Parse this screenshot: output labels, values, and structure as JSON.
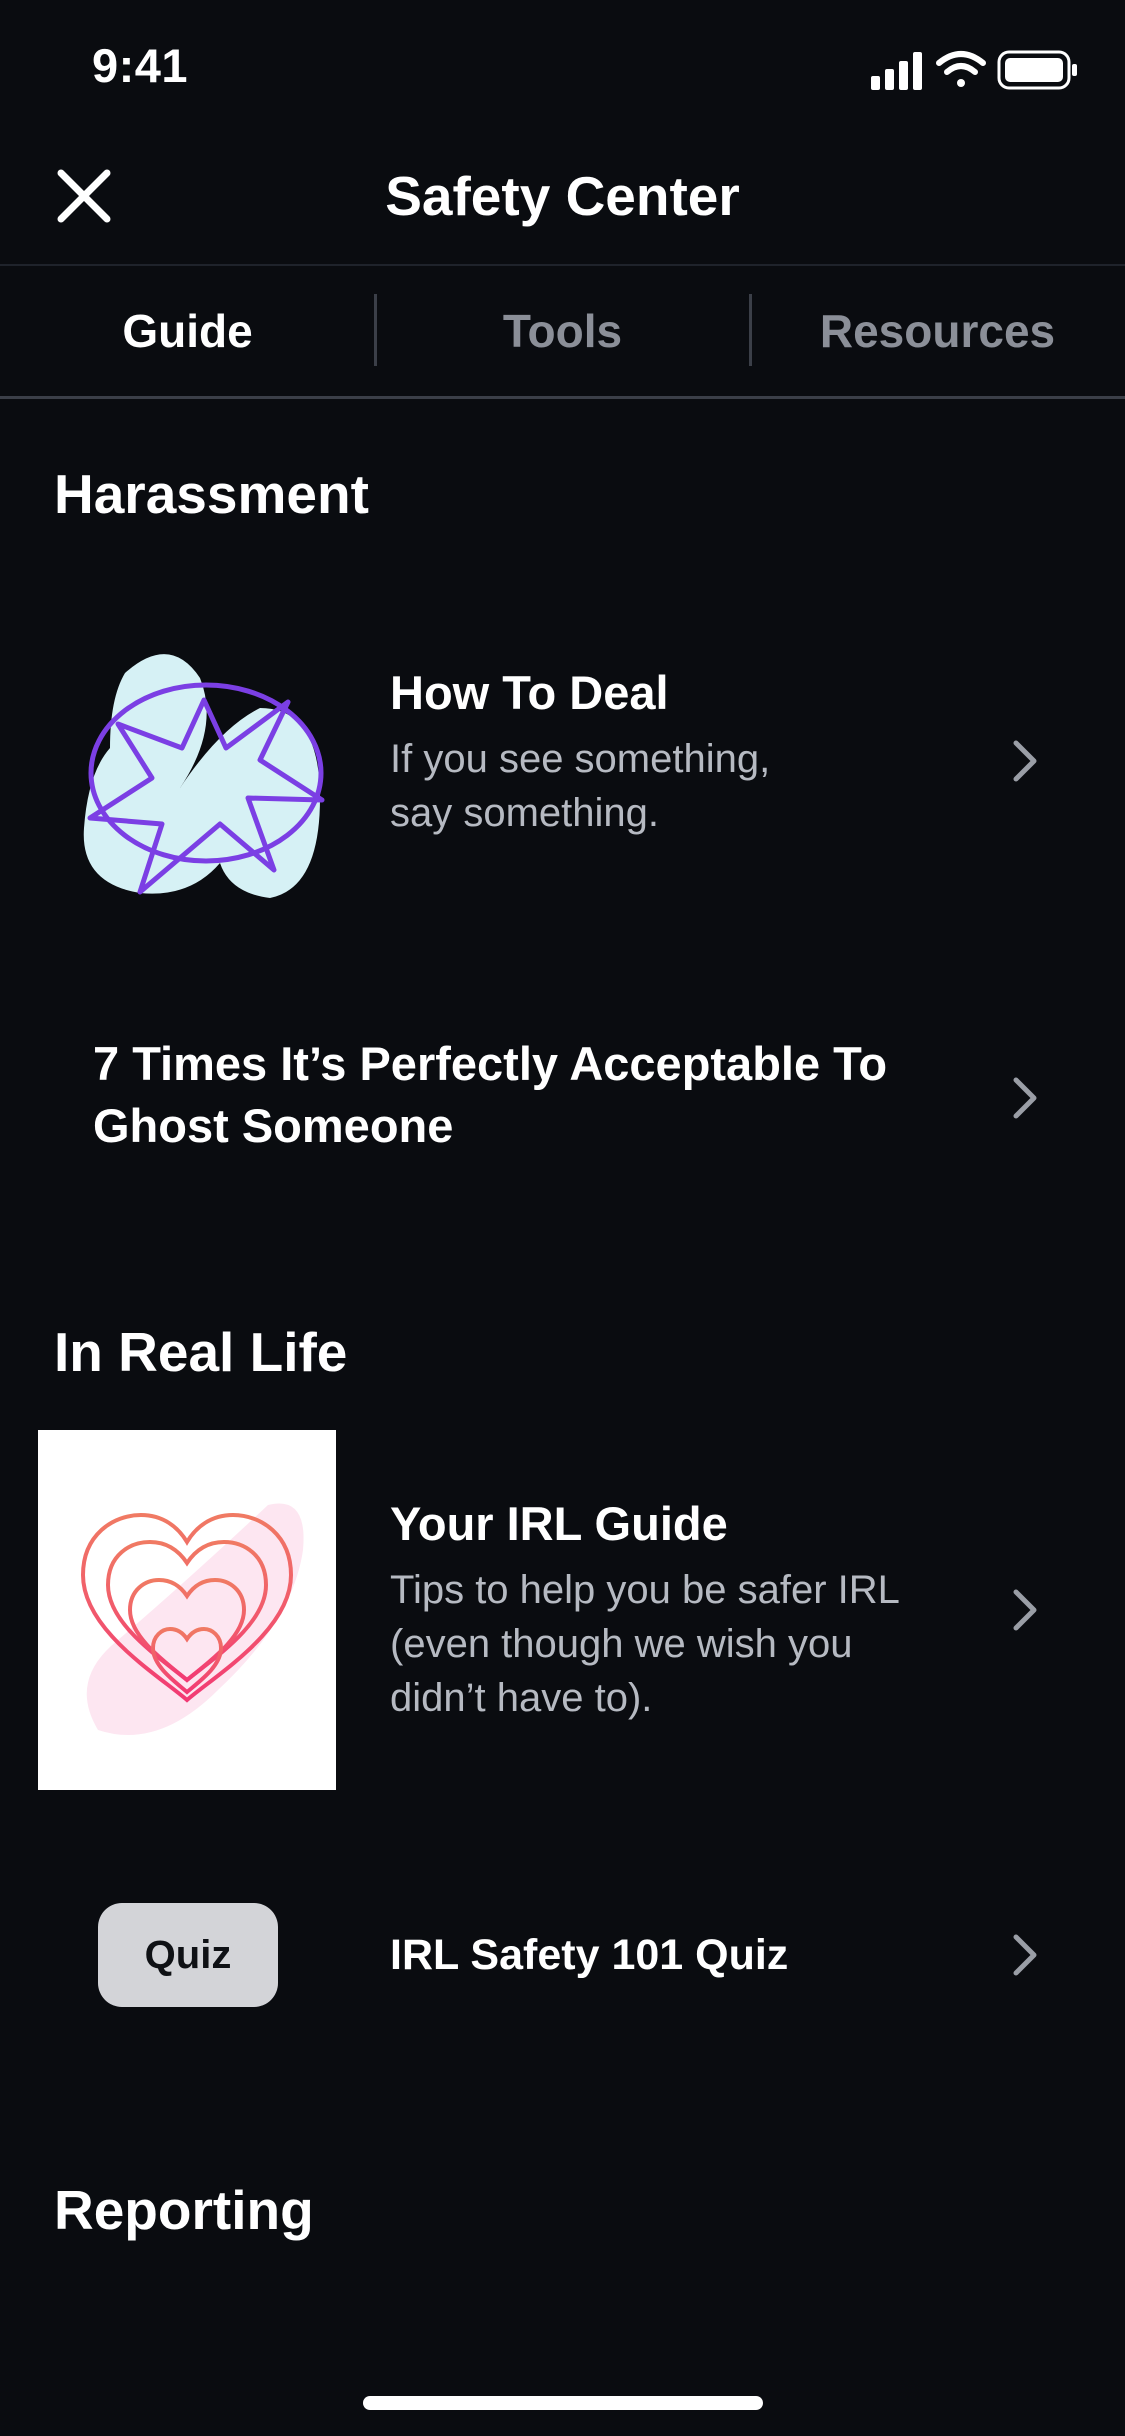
{
  "status_bar": {
    "time": "9:41"
  },
  "header": {
    "title": "Safety Center",
    "close_icon": "close-icon"
  },
  "tabs": [
    {
      "label": "Guide",
      "active": true
    },
    {
      "label": "Tools",
      "active": false
    },
    {
      "label": "Resources",
      "active": false
    }
  ],
  "sections": {
    "harassment": {
      "title": "Harassment",
      "items": [
        {
          "title": "How To Deal",
          "subtitle_line1": "If you see something,",
          "subtitle_line2": "say something."
        },
        {
          "title_line1": "7 Times It’s Perfectly Acceptable To",
          "title_line2": "Ghost Someone"
        }
      ]
    },
    "irl": {
      "title": "In Real Life",
      "items": [
        {
          "title": "Your IRL Guide",
          "subtitle_line1": "Tips to help you be safer IRL",
          "subtitle_line2": "(even though we wish you",
          "subtitle_line3": "didn’t have to)."
        },
        {
          "badge": "Quiz",
          "title": "IRL Safety 101 Quiz"
        }
      ]
    },
    "reporting": {
      "title": "Reporting"
    }
  },
  "colors": {
    "background": "#0a0c10",
    "text": "#ffffff",
    "muted": "#8b8f98",
    "accent_purple": "#7b3fe4",
    "accent_pink": "#f0427a"
  }
}
